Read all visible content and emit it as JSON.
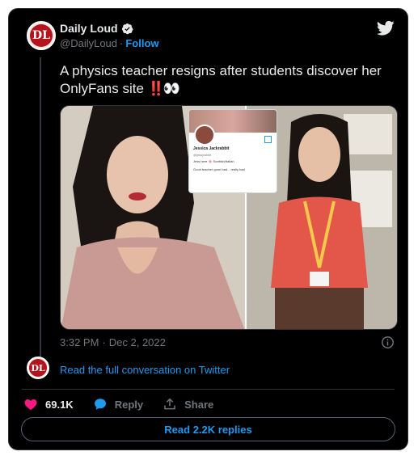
{
  "author": {
    "name": "Daily Loud",
    "handle": "@DailyLoud",
    "separator": "·",
    "follow_label": "Follow",
    "avatar_logo": "DL",
    "verified_icon": "verified-badge-icon"
  },
  "tweet": {
    "text": "A physics teacher resigns after students discover her OnlyFans site",
    "emoji_red": "‼️",
    "emoji_eyes": "👀",
    "time": "3:32 PM",
    "dot": "·",
    "date": "Dec 2, 2022"
  },
  "media": {
    "inset_profile": {
      "name": "Jessica Jackrabbit",
      "handle": "@jessjrabbit",
      "bio_line1": "Jess here 🌸 Scottish/Italian",
      "bio_line2": "Good teacher gone bad... really bad"
    }
  },
  "conversation": {
    "link_text": "Read the full conversation on Twitter"
  },
  "actions": {
    "likes": "69.1K",
    "reply_label": "Reply",
    "share_label": "Share"
  },
  "replies_button": "Read 2.2K replies",
  "colors": {
    "background": "#000000",
    "text": "#e7e9ea",
    "secondary": "#71767b",
    "accent": "#1d9bf0",
    "like": "#f91880",
    "verified": "#e7e9ea"
  }
}
